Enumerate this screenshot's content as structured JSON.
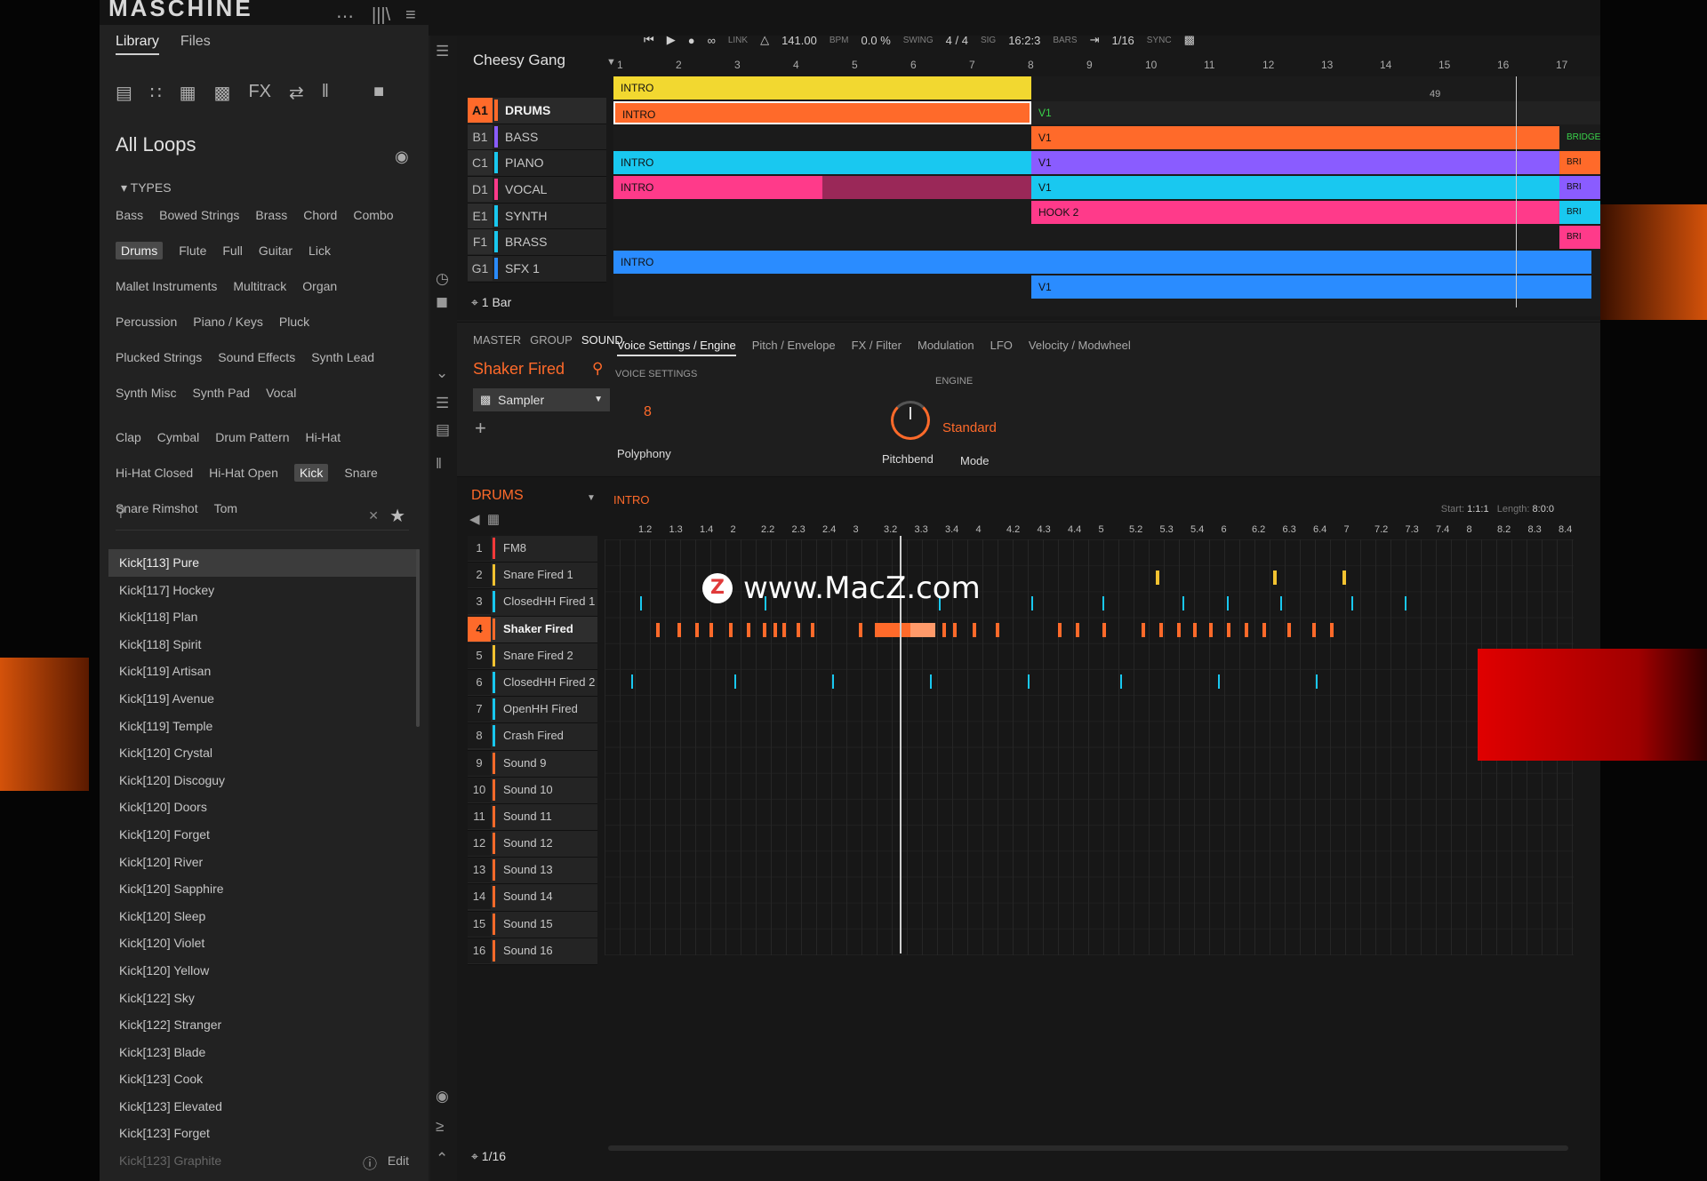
{
  "app": {
    "logo": "MASCHINE"
  },
  "topbar": {
    "more": "⋯",
    "lib_icon": "|||\\",
    "mixer_icon": "≡"
  },
  "transport": {
    "link": "LINK",
    "bpm_value": "141.00",
    "bpm_label": "BPM",
    "swing_value": "0.0 %",
    "swing_label": "SWING",
    "sig_value": "4 / 4",
    "sig_label": "SIG",
    "bars_value": "16:2:3",
    "bars_label": "BARS",
    "quant": "1/16",
    "sync": "SYNC",
    "cpu": "49"
  },
  "library": {
    "tabs": [
      "Library",
      "Files"
    ],
    "heading": "All Loops",
    "types_label": "TYPES",
    "tags_row1": [
      "Bass",
      "Bowed Strings",
      "Brass",
      "Chord",
      "Combo"
    ],
    "tags_row2": [
      "Drums",
      "Flute",
      "Full",
      "Guitar",
      "Lick"
    ],
    "tags_row3": [
      "Mallet Instruments",
      "Multitrack",
      "Organ"
    ],
    "tags_row4": [
      "Percussion",
      "Piano / Keys",
      "Pluck"
    ],
    "tags_row5": [
      "Plucked Strings",
      "Sound Effects",
      "Synth Lead"
    ],
    "tags_row6": [
      "Synth Misc",
      "Synth Pad",
      "Vocal"
    ],
    "tags_row7": [
      "Clap",
      "Cymbal",
      "Drum Pattern",
      "Hi-Hat"
    ],
    "tags_row8": [
      "Hi-Hat Closed",
      "Hi-Hat Open",
      "Kick",
      "Snare"
    ],
    "tags_row9": [
      "Snare Rimshot",
      "Tom"
    ],
    "search_placeholder": "",
    "items": [
      "Kick[113] Pure",
      "Kick[117] Hockey",
      "Kick[118] Plan",
      "Kick[118] Spirit",
      "Kick[119] Artisan",
      "Kick[119] Avenue",
      "Kick[119] Temple",
      "Kick[120] Crystal",
      "Kick[120] Discoguy",
      "Kick[120] Doors",
      "Kick[120] Forget",
      "Kick[120] River",
      "Kick[120] Sapphire",
      "Kick[120] Sleep",
      "Kick[120] Violet",
      "Kick[120] Yellow",
      "Kick[122] Sky",
      "Kick[122] Stranger",
      "Kick[123] Blade",
      "Kick[123] Cook",
      "Kick[123] Elevated",
      "Kick[123] Forget",
      "Kick[123] Graphite"
    ],
    "edit": "Edit"
  },
  "arranger": {
    "project": "Cheesy Gang",
    "groups": [
      {
        "slot": "A1",
        "name": "DRUMS",
        "color": "#ff6a2a"
      },
      {
        "slot": "B1",
        "name": "BASS",
        "color": "#8a5cff"
      },
      {
        "slot": "C1",
        "name": "PIANO",
        "color": "#19c8f0"
      },
      {
        "slot": "D1",
        "name": "VOCAL",
        "color": "#ff3a8a"
      },
      {
        "slot": "E1",
        "name": "SYNTH",
        "color": "#19c8f0"
      },
      {
        "slot": "F1",
        "name": "BRASS",
        "color": "#19c8f0"
      },
      {
        "slot": "G1",
        "name": "SFX 1",
        "color": "#2a8cff"
      }
    ],
    "one_bar": "1 Bar",
    "ticks": [
      "1",
      "2",
      "3",
      "4",
      "5",
      "6",
      "7",
      "8",
      "9",
      "10",
      "11",
      "12",
      "13",
      "14",
      "15",
      "16",
      "17"
    ],
    "scene_intro": "INTRO",
    "clip_intro": "INTRO",
    "clip_v1": "V1",
    "clip_hook2": "HOOK 2",
    "clip_bridge": "BRIDGE",
    "clip_bri": "BRI"
  },
  "sound": {
    "tabs": [
      "MASTER",
      "GROUP",
      "SOUND"
    ],
    "name": "Shaker Fired",
    "plugin": "Sampler",
    "param_tabs": [
      "Voice Settings / Engine",
      "Pitch / Envelope",
      "FX / Filter",
      "Modulation",
      "LFO",
      "Velocity / Modwheel"
    ],
    "voice_settings": "VOICE SETTINGS",
    "engine": "ENGINE",
    "polyphony_value": "8",
    "polyphony": "Polyphony",
    "pitchbend": "Pitchbend",
    "mode_value": "Standard",
    "mode": "Mode"
  },
  "pattern": {
    "group": "DRUMS",
    "pattern_name": "INTRO",
    "start_label": "Start:",
    "start": "1:1:1",
    "length_label": "Length:",
    "length": "8:0:0",
    "ticks": [
      "1.2",
      "1.3",
      "1.4",
      "2",
      "2.2",
      "2.3",
      "2.4",
      "3",
      "3.2",
      "3.3",
      "3.4",
      "4",
      "4.2",
      "4.3",
      "4.4",
      "5",
      "5.2",
      "5.3",
      "5.4",
      "6",
      "6.2",
      "6.3",
      "6.4",
      "7",
      "7.2",
      "7.3",
      "7.4",
      "8",
      "8.2",
      "8.3",
      "8.4"
    ],
    "sounds": [
      {
        "n": "1",
        "name": "FM8",
        "color": "#ff3a3a"
      },
      {
        "n": "2",
        "name": "Snare Fired 1",
        "color": "#f2c230"
      },
      {
        "n": "3",
        "name": "ClosedHH Fired 1",
        "color": "#19c8f0"
      },
      {
        "n": "4",
        "name": "Shaker Fired",
        "color": "#ff6a2a"
      },
      {
        "n": "5",
        "name": "Snare Fired 2",
        "color": "#f2c230"
      },
      {
        "n": "6",
        "name": "ClosedHH Fired 2",
        "color": "#19c8f0"
      },
      {
        "n": "7",
        "name": "OpenHH Fired",
        "color": "#19c8f0"
      },
      {
        "n": "8",
        "name": "Crash Fired",
        "color": "#19c8f0"
      },
      {
        "n": "9",
        "name": "Sound 9",
        "color": "#ff6a2a"
      },
      {
        "n": "10",
        "name": "Sound 10",
        "color": "#ff6a2a"
      },
      {
        "n": "11",
        "name": "Sound 11",
        "color": "#ff6a2a"
      },
      {
        "n": "12",
        "name": "Sound 12",
        "color": "#ff6a2a"
      },
      {
        "n": "13",
        "name": "Sound 13",
        "color": "#ff6a2a"
      },
      {
        "n": "14",
        "name": "Sound 14",
        "color": "#ff6a2a"
      },
      {
        "n": "15",
        "name": "Sound 15",
        "color": "#ff6a2a"
      },
      {
        "n": "16",
        "name": "Sound 16",
        "color": "#ff6a2a"
      }
    ],
    "grid_res": "1/16"
  },
  "watermark": {
    "z": "Z",
    "text": "www.MacZ.com"
  },
  "colors": {
    "accent": "#ff6a2a",
    "cyan": "#19c8f0",
    "pink": "#ff3a8a",
    "purple": "#8a5cff",
    "blue": "#2a8cff",
    "yellow": "#f2c230"
  }
}
